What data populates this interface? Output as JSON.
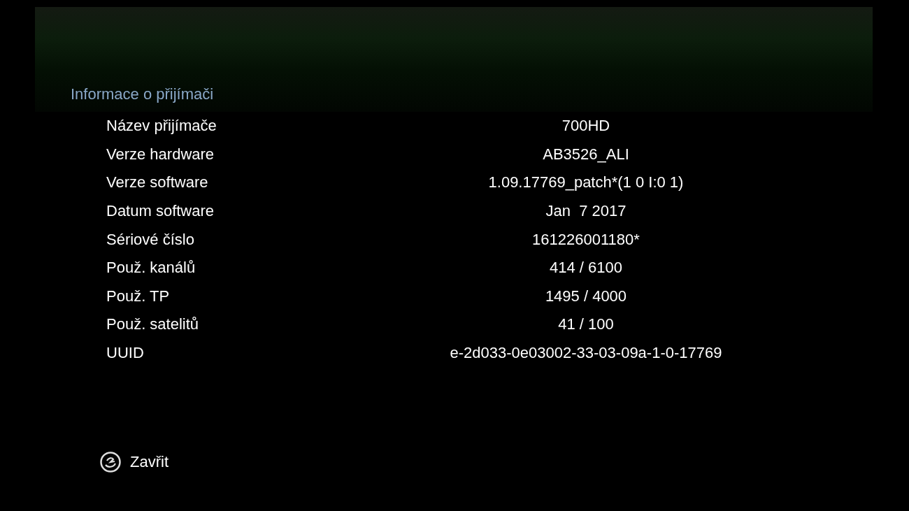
{
  "title": "Informace o přijímači",
  "rows": [
    {
      "label": "Název přijímače",
      "value": "700HD"
    },
    {
      "label": "Verze hardware",
      "value": "AB3526_ALI"
    },
    {
      "label": "Verze software",
      "value": "1.09.17769_patch*(1 0 I:0 1)"
    },
    {
      "label": "Datum software",
      "value": "Jan  7 2017"
    },
    {
      "label": "Sériové číslo",
      "value": "161226001180*"
    },
    {
      "label": "Použ. kanálů",
      "value": "414 / 6100"
    },
    {
      "label": "Použ. TP",
      "value": "1495 / 4000"
    },
    {
      "label": "Použ. satelitů",
      "value": "41 / 100"
    },
    {
      "label": "UUID",
      "value": "e-2d033-0e03002-33-03-09a-1-0-17769"
    }
  ],
  "footer": {
    "label": "Zavřit"
  }
}
